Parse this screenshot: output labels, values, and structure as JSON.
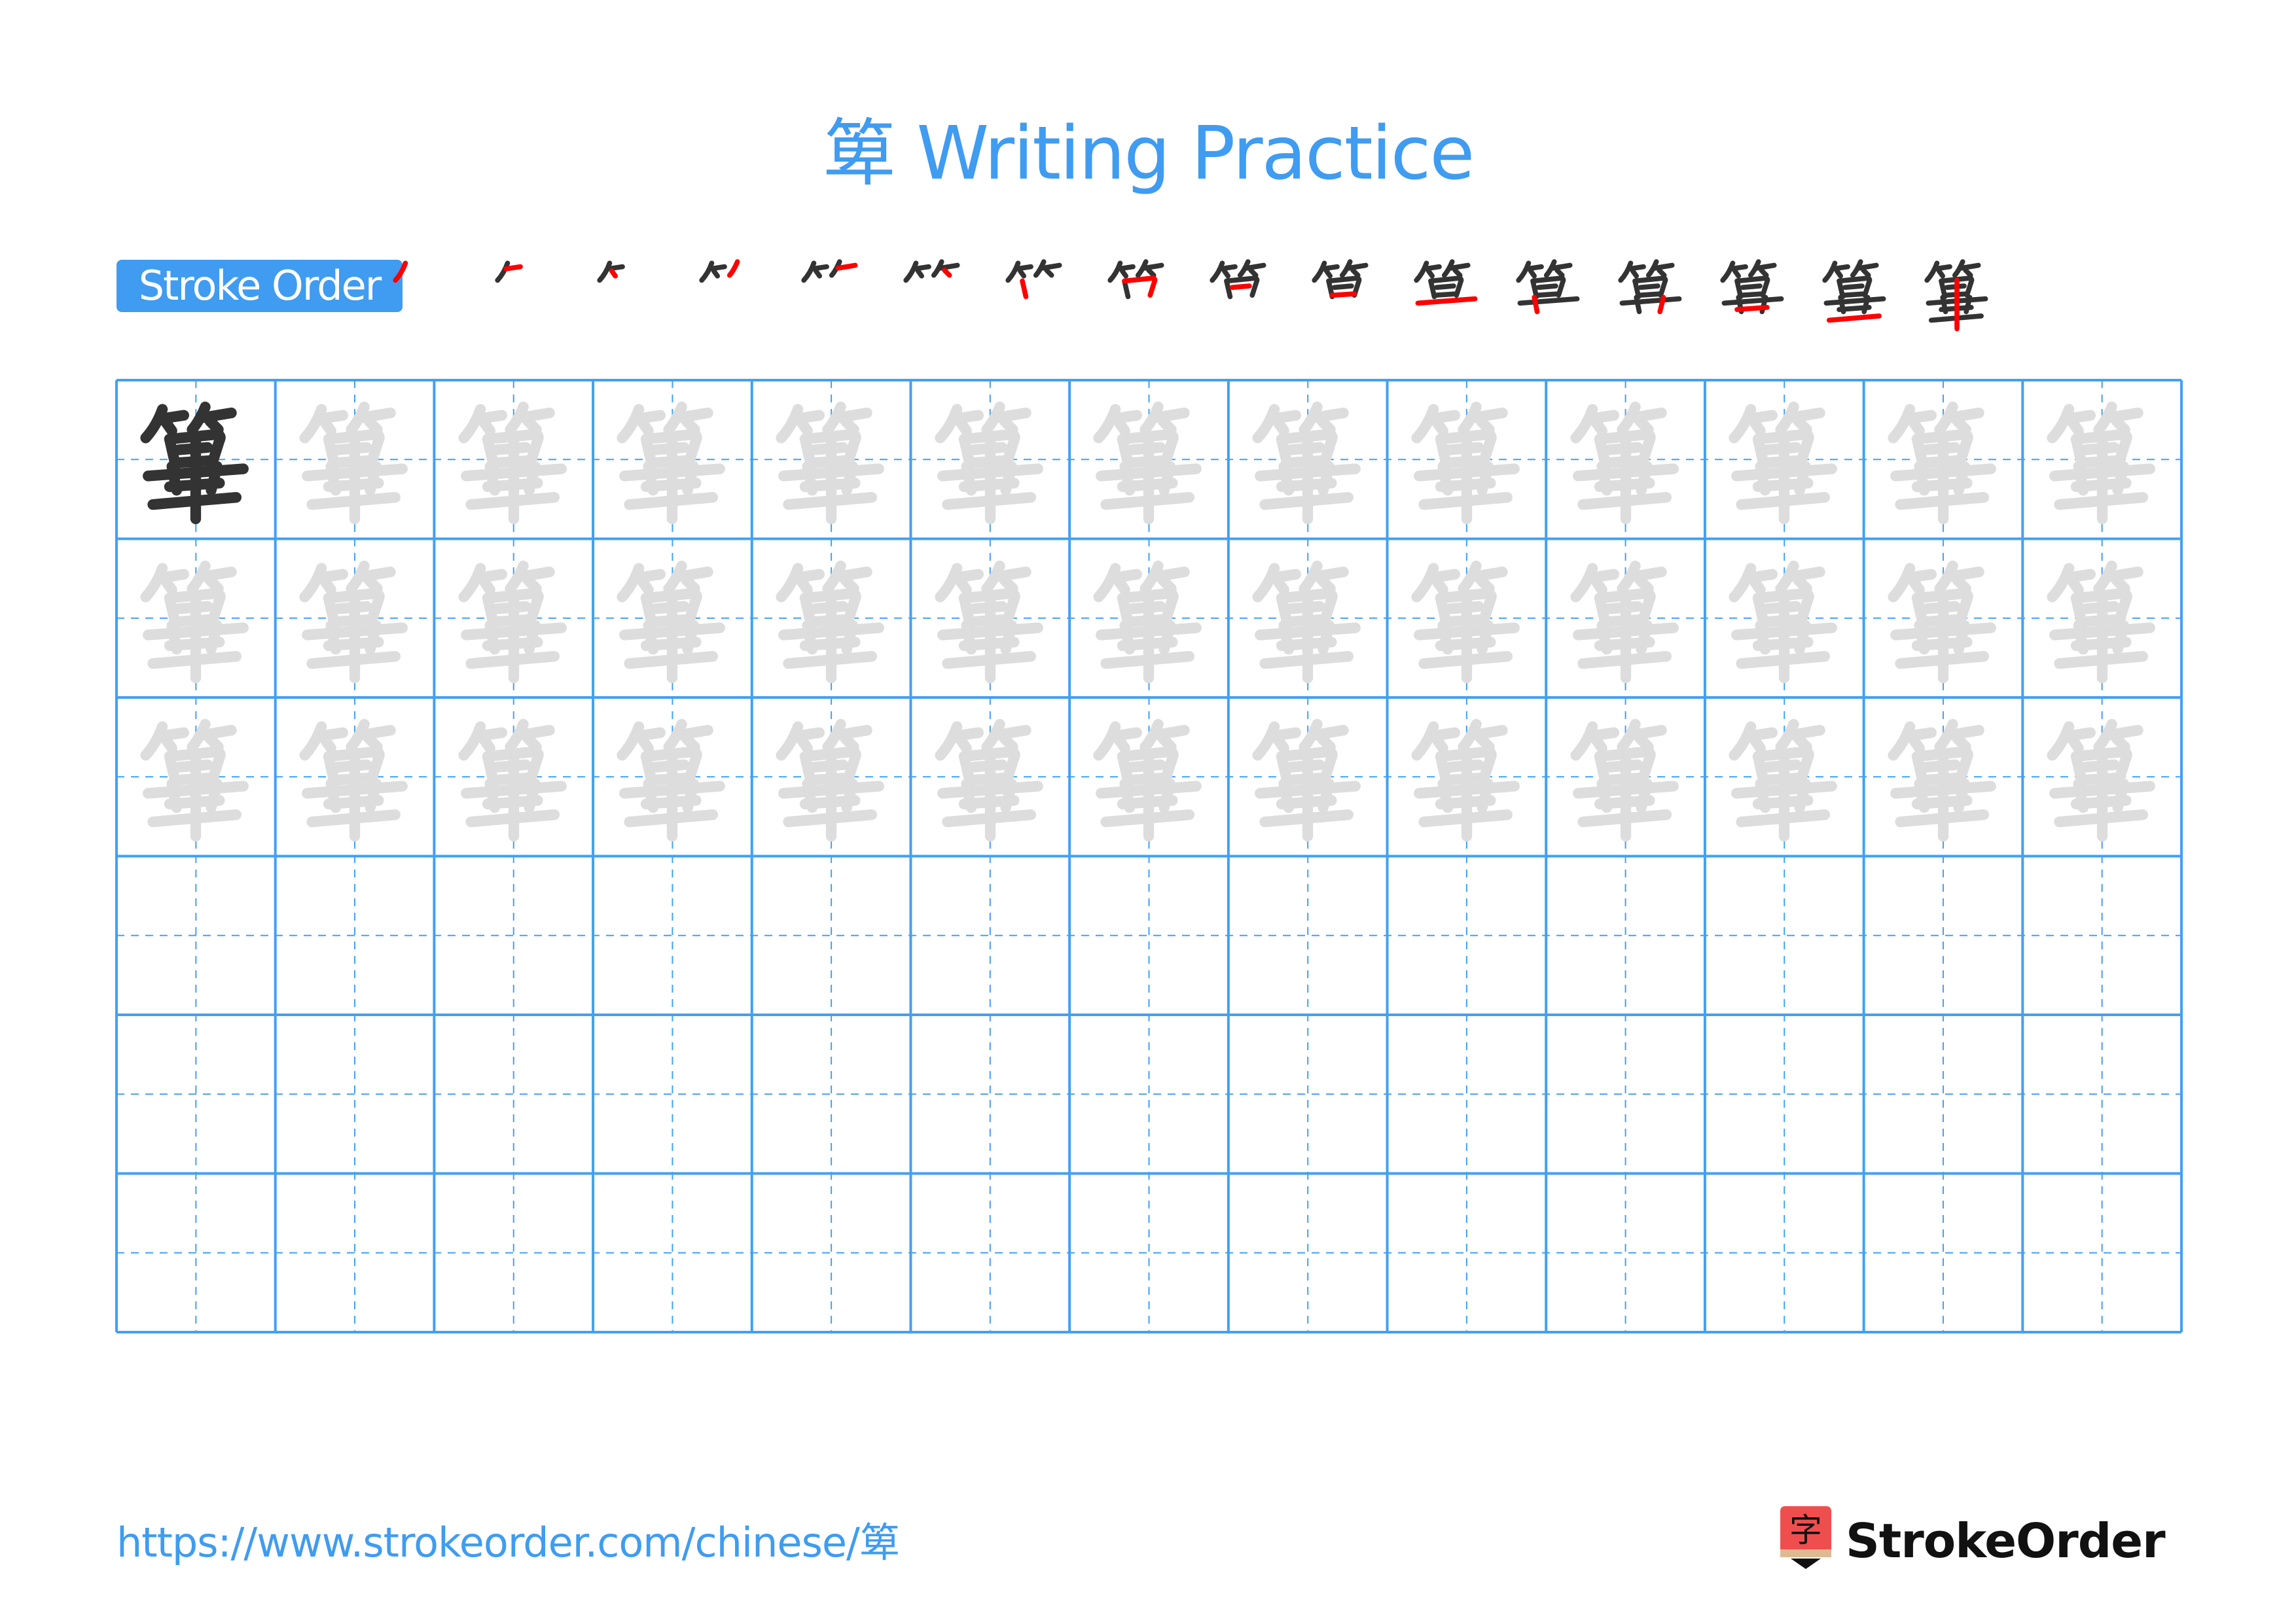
{
  "page": {
    "title": "箄 Writing Practice",
    "character": "箄"
  },
  "stroke_order": {
    "label": "Stroke Order",
    "total_strokes": 16,
    "steps": [
      1,
      2,
      3,
      4,
      5,
      6,
      7,
      8,
      9,
      10,
      11,
      12,
      13,
      14,
      15,
      16
    ],
    "colors": {
      "done": "#333333",
      "current": "#ff0000"
    }
  },
  "grid": {
    "columns": 13,
    "rows": 6,
    "model_cells": 1,
    "trace_rows": 3,
    "empty_rows": 3,
    "colors": {
      "line": "#42a0f2",
      "guide": "#42a0f2",
      "model": "#333333",
      "trace": "#dddddd"
    }
  },
  "footer": {
    "url": "https://www.strokeorder.com/chinese/箄",
    "brand": "StrokeOrder",
    "logo_glyph": "字",
    "logo_colors": {
      "top": "#f04e4e",
      "band": "#deb992",
      "tip": "#111111"
    }
  },
  "theme": {
    "accent": "#3f9cf0"
  }
}
